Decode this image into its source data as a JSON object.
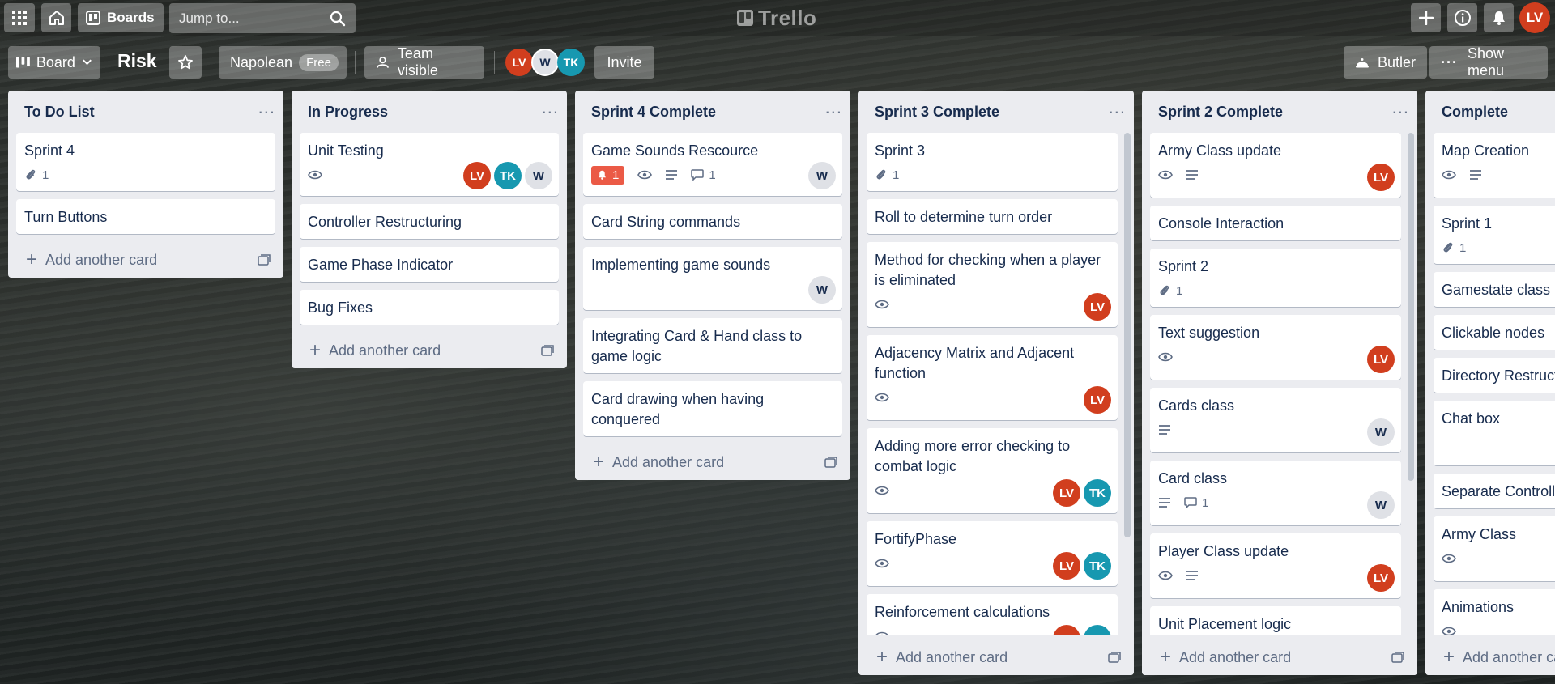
{
  "header": {
    "boards_label": "Boards",
    "search_placeholder": "Jump to...",
    "logo_text": "Trello",
    "user_initials": "LV"
  },
  "board": {
    "view_label": "Board",
    "title": "Risk",
    "team_name": "Napolean",
    "team_plan": "Free",
    "visibility": "Team visible",
    "members": [
      "LV",
      "W",
      "TK"
    ],
    "invite_label": "Invite",
    "butler_label": "Butler",
    "show_menu_label": "Show menu"
  },
  "add_card_label": "Add another card",
  "lists": [
    {
      "title": "To Do List",
      "cards": [
        {
          "title": "Sprint 4",
          "attachments": "1"
        },
        {
          "title": "Turn Buttons"
        }
      ]
    },
    {
      "title": "In Progress",
      "cards": [
        {
          "title": "Unit Testing",
          "members": [
            "LV",
            "TK",
            "W"
          ]
        },
        {
          "title": "Controller Restructuring"
        },
        {
          "title": "Game Phase Indicator"
        },
        {
          "title": "Bug Fixes"
        }
      ]
    },
    {
      "title": "Sprint 4 Complete",
      "cards": [
        {
          "title": "Game Sounds Rescource",
          "notifications": "1",
          "comments": "1",
          "members": [
            "W"
          ]
        },
        {
          "title": "Card String commands"
        },
        {
          "title": "Implementing game sounds",
          "members": [
            "W"
          ]
        },
        {
          "title": "Integrating Card & Hand class to game logic"
        },
        {
          "title": "Card drawing when having conquered"
        }
      ]
    },
    {
      "title": "Sprint 3 Complete",
      "cards": [
        {
          "title": "Sprint 3",
          "attachments": "1"
        },
        {
          "title": "Roll to determine turn order"
        },
        {
          "title": "Method for checking when a player is eliminated",
          "members": [
            "LV"
          ]
        },
        {
          "title": "Adjacency Matrix and Adjacent function",
          "members": [
            "LV"
          ]
        },
        {
          "title": "Adding more error checking to combat logic",
          "members": [
            "LV",
            "TK"
          ]
        },
        {
          "title": "FortifyPhase",
          "members": [
            "LV",
            "TK"
          ]
        },
        {
          "title": "Reinforcement calculations",
          "members": [
            "LV",
            "TK"
          ]
        }
      ]
    },
    {
      "title": "Sprint 2 Complete",
      "cards": [
        {
          "title": "Army Class update",
          "members": [
            "LV"
          ]
        },
        {
          "title": "Console Interaction"
        },
        {
          "title": "Sprint 2",
          "attachments": "1"
        },
        {
          "title": "Text suggestion",
          "members": [
            "LV"
          ]
        },
        {
          "title": "Cards class",
          "members": [
            "W"
          ]
        },
        {
          "title": "Card class",
          "comments": "1",
          "members": [
            "W"
          ]
        },
        {
          "title": "Player Class update",
          "members": [
            "LV"
          ]
        },
        {
          "title": "Unit Placement logic"
        }
      ]
    },
    {
      "title": "Complete",
      "cards": [
        {
          "title": "Map Creation"
        },
        {
          "title": "Sprint 1",
          "attachments": "1"
        },
        {
          "title": "Gamestate class"
        },
        {
          "title": "Clickable nodes"
        },
        {
          "title": "Directory Restructu"
        },
        {
          "title": "Chat box"
        },
        {
          "title": "Separate Controlle"
        },
        {
          "title": "Army Class"
        },
        {
          "title": "Animations"
        }
      ]
    }
  ]
}
